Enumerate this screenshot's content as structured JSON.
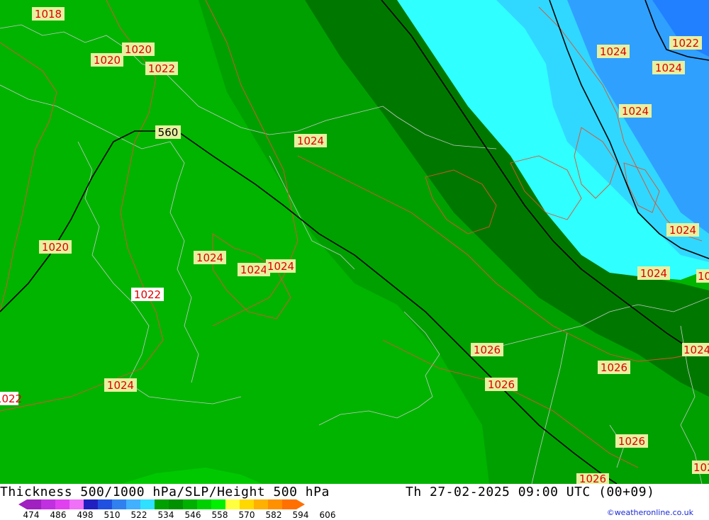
{
  "map": {
    "title": "Thickness 500/1000 hPa/SLP/Height 500 hPa",
    "datetime": "Th 27-02-2025 09:00 UTC (00+09)",
    "credit": "©weatheronline.co.uk",
    "height_contour_label": "560",
    "pressure_labels": [
      "1018",
      "1020",
      "1020",
      "1022",
      "1024",
      "1020",
      "1024",
      "1024",
      "1024",
      "1022",
      "1024",
      "1022",
      "1026",
      "1026",
      "1026",
      "1026",
      "1026",
      "1024",
      "1024",
      "1024",
      "1024",
      "1024",
      "1022",
      "1024",
      "102",
      "102"
    ]
  },
  "legend": {
    "ticks": [
      "474",
      "486",
      "498",
      "510",
      "522",
      "534",
      "546",
      "558",
      "570",
      "582",
      "594",
      "606"
    ],
    "colors": [
      "#a020c0",
      "#c030e0",
      "#e040f0",
      "#f070f8",
      "#2020c0",
      "#2050e0",
      "#3080f0",
      "#40b0ff",
      "#30e0ff",
      "#00a000",
      "#009000",
      "#00b000",
      "#00d000",
      "#00f000",
      "#ffff40",
      "#ffd800",
      "#ffb000",
      "#ff9000",
      "#ff7000"
    ]
  },
  "colors": {
    "green_base": "#00b400",
    "green_mid": "#00a000",
    "green_dark": "#007800",
    "green_light": "#00c800",
    "cyan": "#30ffff",
    "cyan_mid": "#30d8ff",
    "blue_light": "#30a0ff",
    "blue": "#2080ff",
    "label_bg": "#e8f0a0",
    "label_red": "#e00000",
    "isobar": "#e05030"
  }
}
